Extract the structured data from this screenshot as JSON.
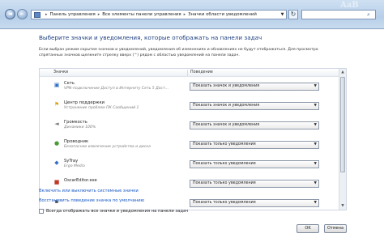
{
  "window": {
    "address": {
      "crumbs": [
        "Панель управления",
        "Все элементы панели управления",
        "Значки области уведомлений"
      ],
      "separator": "▸"
    },
    "search": {
      "icon": "search-icon"
    },
    "ghost_text": "AaB",
    "nav": {
      "back": "◄",
      "forward": "►"
    }
  },
  "main": {
    "heading": "Выберите значки и уведомления, которые отображать на панели задач",
    "description": "Если выбран режим скрытия значков и уведомлений, уведомления об изменениях и обновлениях не будут отображаться. Для просмотра спрятанных значков щелкните стрелку вверх (^) рядом с областью уведомлений на панели задач.",
    "columns": {
      "icons": "Значки",
      "behavior": "Поведение"
    },
    "rows": [
      {
        "name": "Сеть",
        "sub": "VPN-подключение Доступ в Интернету Сеть 5 Дост...",
        "behavior": "Показать значок и уведомления",
        "icon": "network-icon"
      },
      {
        "name": "Центр поддержки",
        "sub": "Устранение проблем ПК Сообщений 1",
        "behavior": "Показать значок и уведомления",
        "icon": "action-center-flag-icon"
      },
      {
        "name": "Громкость",
        "sub": "Динамики 100%",
        "behavior": "Показать значок и уведомления",
        "icon": "volume-icon"
      },
      {
        "name": "Проводник",
        "sub": "Безопасное извлечение устройства и диска",
        "behavior": "Показать только уведомления",
        "icon": "safely-remove-icon"
      },
      {
        "name": "SyTray",
        "sub": "Ergo Media",
        "behavior": "Показать только уведомления",
        "icon": "sytray-icon"
      },
      {
        "name": "OscarEditor.exe",
        "sub": "",
        "behavior": "Показать только уведомления",
        "icon": "app-icon"
      },
      {
        "name": "",
        "sub": "",
        "behavior": "Показать только уведомления",
        "icon": "app-icon"
      }
    ],
    "dropdown_arrow": "▼",
    "links": {
      "system_icons": "Включить или выключить системные значки",
      "restore": "Восстановить поведение значка по умолчанию"
    },
    "always_show": {
      "label": "Всегда отображать все значки и уведомления на панели задач",
      "checked": false
    },
    "buttons": {
      "ok": "OK",
      "cancel": "Отмена"
    }
  }
}
